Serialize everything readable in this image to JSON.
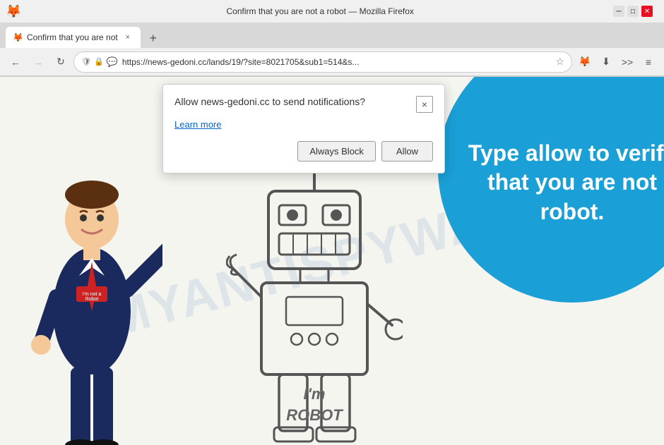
{
  "browser": {
    "title": "Confirm that you are not a robot — Mozilla Firefox",
    "tab": {
      "label": "Confirm that you are not",
      "close_label": "×"
    },
    "new_tab_label": "+",
    "address": "https://news-gedoni.cc/lands/19/?site=8021705&sub1=514&s...",
    "back_disabled": false,
    "forward_disabled": true
  },
  "popup": {
    "title": "Allow news-gedoni.cc to send notifications?",
    "learn_more": "Learn more",
    "always_block_label": "Always Block",
    "allow_label": "Allow",
    "close_label": "×"
  },
  "page": {
    "watermark": "MYANTISPYWARE",
    "circle_text": "Type allow to verify that you are not robot.",
    "robot_label": "I'm\nROBOT"
  },
  "colors": {
    "blue_circle": "#1a9fd6",
    "watermark": "rgba(160,200,230,0.3)"
  }
}
